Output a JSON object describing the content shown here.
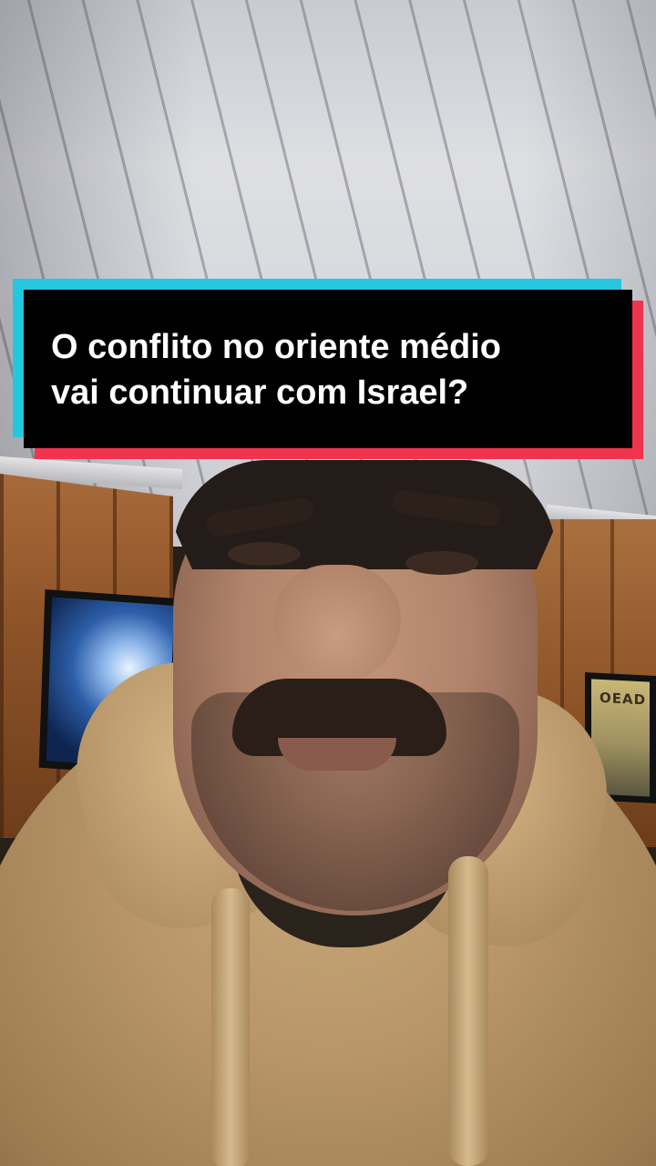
{
  "caption": {
    "line1": "O conflito no oriente médio",
    "line2": "vai continuar com Israel?",
    "accent_left": "#25c6e0",
    "accent_right": "#f0334e",
    "background": "#000000",
    "text_color": "#ffffff"
  },
  "poster_right_text": "OEAD"
}
